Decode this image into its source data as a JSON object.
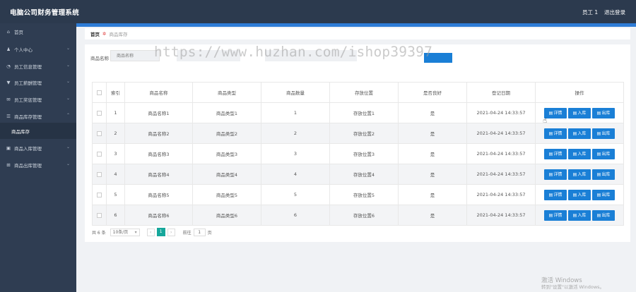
{
  "header": {
    "title": "电脑公司财务管理系统",
    "user": "员工 1",
    "logout": "退出登录"
  },
  "sidebar": {
    "items": [
      {
        "label": "首页",
        "icon": "home-icon",
        "glyph": "⌂",
        "chevron": ""
      },
      {
        "label": "个人中心",
        "icon": "user-icon",
        "glyph": "♟",
        "chevron": "⌄"
      },
      {
        "label": "员工信息管理",
        "icon": "clock-icon",
        "glyph": "◔",
        "chevron": "⌄"
      },
      {
        "label": "员工薪酬管理",
        "icon": "shield-icon",
        "glyph": "▼",
        "chevron": "⌄"
      },
      {
        "label": "员工奖惩管理",
        "icon": "mail-icon",
        "glyph": "✉",
        "chevron": "⌄"
      },
      {
        "label": "商品库存管理",
        "icon": "list-icon",
        "glyph": "☰",
        "chevron": "⌃"
      },
      {
        "label": "商品库存",
        "icon": "",
        "glyph": "",
        "chevron": ""
      },
      {
        "label": "商品入库管理",
        "icon": "inbox-icon",
        "glyph": "▣",
        "chevron": "⌄"
      },
      {
        "label": "商品出库管理",
        "icon": "grid-icon",
        "glyph": "⊞",
        "chevron": "⌄"
      }
    ]
  },
  "breadcrumb": {
    "home": "首页",
    "sep": "✲",
    "current": "商品库存"
  },
  "search": {
    "label": "商品名称",
    "placeholder": "商品名称"
  },
  "watermark": "https://www.huzhan.com/ishop39397",
  "table": {
    "headers": [
      "",
      "索引",
      "商品名称",
      "商品类型",
      "商品数量",
      "存放位置",
      "是否良好",
      "登记日期",
      "操作"
    ],
    "rows": [
      [
        "1",
        "商品名称1",
        "商品类型1",
        "1",
        "存放位置1",
        "是",
        "2021-04-24 14:33:57"
      ],
      [
        "2",
        "商品名称2",
        "商品类型2",
        "2",
        "存放位置2",
        "是",
        "2021-04-24 14:33:57"
      ],
      [
        "3",
        "商品名称3",
        "商品类型3",
        "3",
        "存放位置3",
        "是",
        "2021-04-24 14:33:57"
      ],
      [
        "4",
        "商品名称4",
        "商品类型4",
        "4",
        "存放位置4",
        "是",
        "2021-04-24 14:33:57"
      ],
      [
        "5",
        "商品名称5",
        "商品类型5",
        "5",
        "存放位置5",
        "是",
        "2021-04-24 14:33:57"
      ],
      [
        "6",
        "商品名称6",
        "商品类型6",
        "6",
        "存放位置6",
        "是",
        "2021-04-24 14:33:57"
      ]
    ],
    "actions": [
      "详情",
      "入库",
      "出库"
    ]
  },
  "pager": {
    "total": "共 6 条",
    "size": "10条/页",
    "prev": "‹",
    "page": "1",
    "next": "›",
    "goto": "前往",
    "goto_value": "1",
    "unit": "页"
  },
  "windows": {
    "line1": "激活 Windows",
    "line2": "转到\"设置\"以激活 Windows。"
  },
  "colors": {
    "primary": "#1a7fd6",
    "header_bg": "#2c3a4e",
    "sidebar_bg": "#2f3d52",
    "pager_active": "#16a79b"
  }
}
